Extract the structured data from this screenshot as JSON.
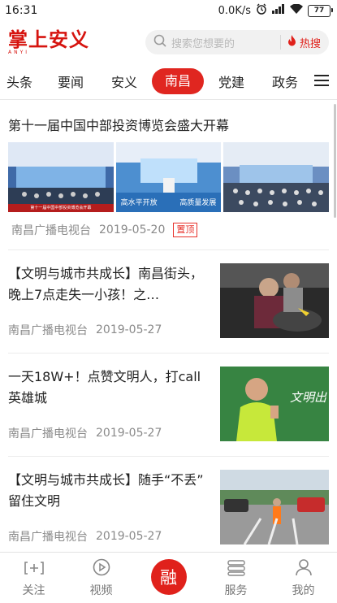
{
  "status_bar": {
    "time": "16:31",
    "speed": "0.0K/s",
    "battery": "77"
  },
  "header": {
    "logo_text": "掌上安义",
    "logo_sub": "ANYI",
    "search_placeholder": "搜索您想要的",
    "hot_search_label": "热搜"
  },
  "tabs": [
    {
      "label": "头条"
    },
    {
      "label": "要闻"
    },
    {
      "label": "安义"
    },
    {
      "label": "南昌",
      "active": true
    },
    {
      "label": "党建"
    },
    {
      "label": "政务"
    }
  ],
  "feed": {
    "featured": {
      "title": "第十一届中国中部投资博览会盛大开幕",
      "image_captions": [
        "第十一届中国中部投资博览会开幕",
        "高水平开放",
        "高质量发展"
      ],
      "source": "南昌广播电视台",
      "date": "2019-05-20",
      "badge": "置顶"
    },
    "items": [
      {
        "title": "【文明与城市共成长】南昌街头，晚上7点走失一小孩！之…",
        "source": "南昌广播电视台",
        "date": "2019-05-27"
      },
      {
        "title": "一天18W+！点赞文明人，打call英雄城",
        "source": "南昌广播电视台",
        "date": "2019-05-27",
        "image_caption": "文明出"
      },
      {
        "title": "【文明与城市共成长】随手“不丢” 留住文明",
        "source": "南昌广播电视台",
        "date": "2019-05-27"
      }
    ]
  },
  "bottom_nav": {
    "follow": "关注",
    "video": "视频",
    "center": "融",
    "service": "服务",
    "mine": "我的"
  }
}
